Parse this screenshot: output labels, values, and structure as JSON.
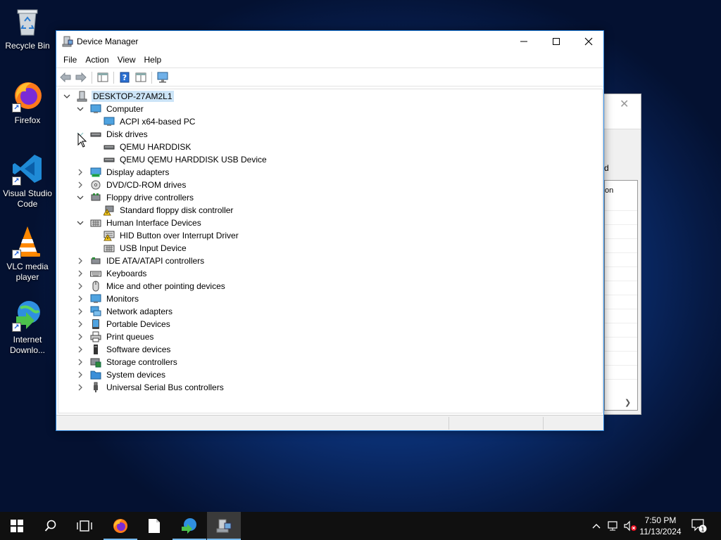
{
  "desktop": {
    "icons": [
      {
        "label": "Recycle Bin"
      },
      {
        "label": "Firefox"
      },
      {
        "label": "Visual Studio Code"
      },
      {
        "label": "VLC media player"
      },
      {
        "label": "Internet Downlo..."
      }
    ]
  },
  "background_dialog": {
    "fragment_1": "d",
    "fragment_2": "on"
  },
  "window": {
    "title": "Device Manager",
    "menu": [
      "File",
      "Action",
      "View",
      "Help"
    ],
    "tree": {
      "root": "DESKTOP-27AM2L1",
      "nodes": [
        {
          "label": "Computer",
          "expanded": true,
          "icon": "computer-icon"
        },
        {
          "label": "ACPI x64-based PC",
          "child": true,
          "icon": "monitor-icon"
        },
        {
          "label": "Disk drives",
          "expanded": true,
          "icon": "disk-icon"
        },
        {
          "label": "QEMU HARDDISK",
          "child": true,
          "icon": "disk-icon"
        },
        {
          "label": "QEMU QEMU HARDDISK USB Device",
          "child": true,
          "icon": "disk-icon"
        },
        {
          "label": "Display adapters",
          "expanded": false,
          "icon": "display-adapter-icon"
        },
        {
          "label": "DVD/CD-ROM drives",
          "expanded": false,
          "icon": "dvd-icon"
        },
        {
          "label": "Floppy drive controllers",
          "expanded": true,
          "icon": "controller-icon"
        },
        {
          "label": "Standard floppy disk controller",
          "child": true,
          "icon": "warning-controller-icon"
        },
        {
          "label": "Human Interface Devices",
          "expanded": true,
          "icon": "hid-icon"
        },
        {
          "label": "HID Button over Interrupt Driver",
          "child": true,
          "icon": "warning-hid-icon"
        },
        {
          "label": "USB Input Device",
          "child": true,
          "icon": "hid-icon"
        },
        {
          "label": "IDE ATA/ATAPI controllers",
          "expanded": false,
          "icon": "ide-icon"
        },
        {
          "label": "Keyboards",
          "expanded": false,
          "icon": "keyboard-icon"
        },
        {
          "label": "Mice and other pointing devices",
          "expanded": false,
          "icon": "mouse-icon"
        },
        {
          "label": "Monitors",
          "expanded": false,
          "icon": "monitor-icon"
        },
        {
          "label": "Network adapters",
          "expanded": false,
          "icon": "network-icon"
        },
        {
          "label": "Portable Devices",
          "expanded": false,
          "icon": "portable-device-icon"
        },
        {
          "label": "Print queues",
          "expanded": false,
          "icon": "printer-icon"
        },
        {
          "label": "Software devices",
          "expanded": false,
          "icon": "software-device-icon"
        },
        {
          "label": "Storage controllers",
          "expanded": false,
          "icon": "storage-icon"
        },
        {
          "label": "System devices",
          "expanded": false,
          "icon": "system-folder-icon"
        },
        {
          "label": "Universal Serial Bus controllers",
          "expanded": false,
          "icon": "usb-icon"
        }
      ]
    }
  },
  "taskbar": {
    "time": "7:50 PM",
    "date": "11/13/2024",
    "notification_count": "1"
  },
  "colors": {
    "accent": "#1f7bd6",
    "selection": "#cce4f7",
    "taskbar": "#101010"
  }
}
